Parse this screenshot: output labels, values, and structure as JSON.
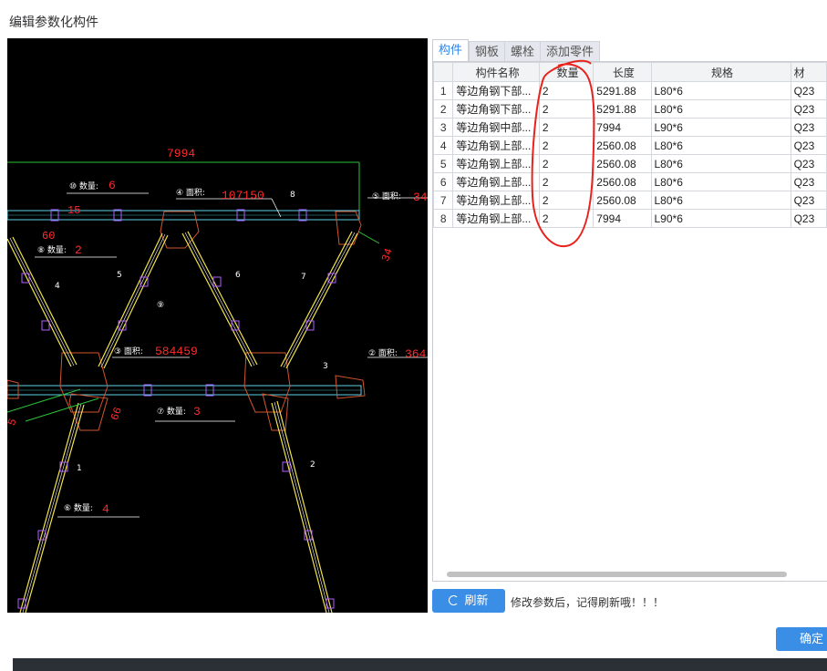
{
  "dialog": {
    "title": "编辑参数化构件"
  },
  "drawing": {
    "dimension": "7994",
    "labels": [
      {
        "prefix": "⑩ 数量:",
        "value": "6"
      },
      {
        "prefix": "④ 面积:",
        "value": "107150"
      },
      {
        "prefix": "⑤ 面积:",
        "value": "34"
      },
      {
        "prefix": "⑧ 数量:",
        "value": "2"
      },
      {
        "prefix": "③ 面积:",
        "value": "584459"
      },
      {
        "prefix": "② 面积:",
        "value": "364"
      },
      {
        "prefix": "⑦ 数量:",
        "value": "3"
      },
      {
        "prefix": "⑥ 数量:",
        "value": "4"
      }
    ],
    "part_numbers": [
      "8",
      "4",
      "5",
      "⑨",
      "6",
      "7",
      "3",
      "1",
      "2"
    ],
    "misc_numbers": [
      "15",
      "60",
      "34",
      "66",
      "5"
    ]
  },
  "tabs": [
    {
      "label": "构件",
      "active": true
    },
    {
      "label": "钢板",
      "active": false
    },
    {
      "label": "螺栓",
      "active": false
    },
    {
      "label": "添加零件",
      "active": false
    }
  ],
  "table": {
    "headers": [
      "",
      "构件名称",
      "数量",
      "长度",
      "规格",
      "材"
    ],
    "rows": [
      {
        "idx": "1",
        "name": "等边角钢下部...",
        "qty": "2",
        "length": "5291.88",
        "spec": "L80*6",
        "mat": "Q23"
      },
      {
        "idx": "2",
        "name": "等边角钢下部...",
        "qty": "2",
        "length": "5291.88",
        "spec": "L80*6",
        "mat": "Q23"
      },
      {
        "idx": "3",
        "name": "等边角钢中部...",
        "qty": "2",
        "length": "7994",
        "spec": "L90*6",
        "mat": "Q23"
      },
      {
        "idx": "4",
        "name": "等边角钢上部...",
        "qty": "2",
        "length": "2560.08",
        "spec": "L80*6",
        "mat": "Q23"
      },
      {
        "idx": "5",
        "name": "等边角钢上部...",
        "qty": "2",
        "length": "2560.08",
        "spec": "L80*6",
        "mat": "Q23"
      },
      {
        "idx": "6",
        "name": "等边角钢上部...",
        "qty": "2",
        "length": "2560.08",
        "spec": "L80*6",
        "mat": "Q23"
      },
      {
        "idx": "7",
        "name": "等边角钢上部...",
        "qty": "2",
        "length": "2560.08",
        "spec": "L80*6",
        "mat": "Q23"
      },
      {
        "idx": "8",
        "name": "等边角钢上部...",
        "qty": "2",
        "length": "7994",
        "spec": "L90*6",
        "mat": "Q23"
      }
    ]
  },
  "footer": {
    "refresh_label": "刷新",
    "refresh_icon": "loading-spinner-icon",
    "hint": "修改参数后，记得刷新哦！！！",
    "ok_label": "确定"
  },
  "colors": {
    "accent": "#3a8ee6",
    "annotation": "#e8231e",
    "cad_background": "#000000"
  }
}
